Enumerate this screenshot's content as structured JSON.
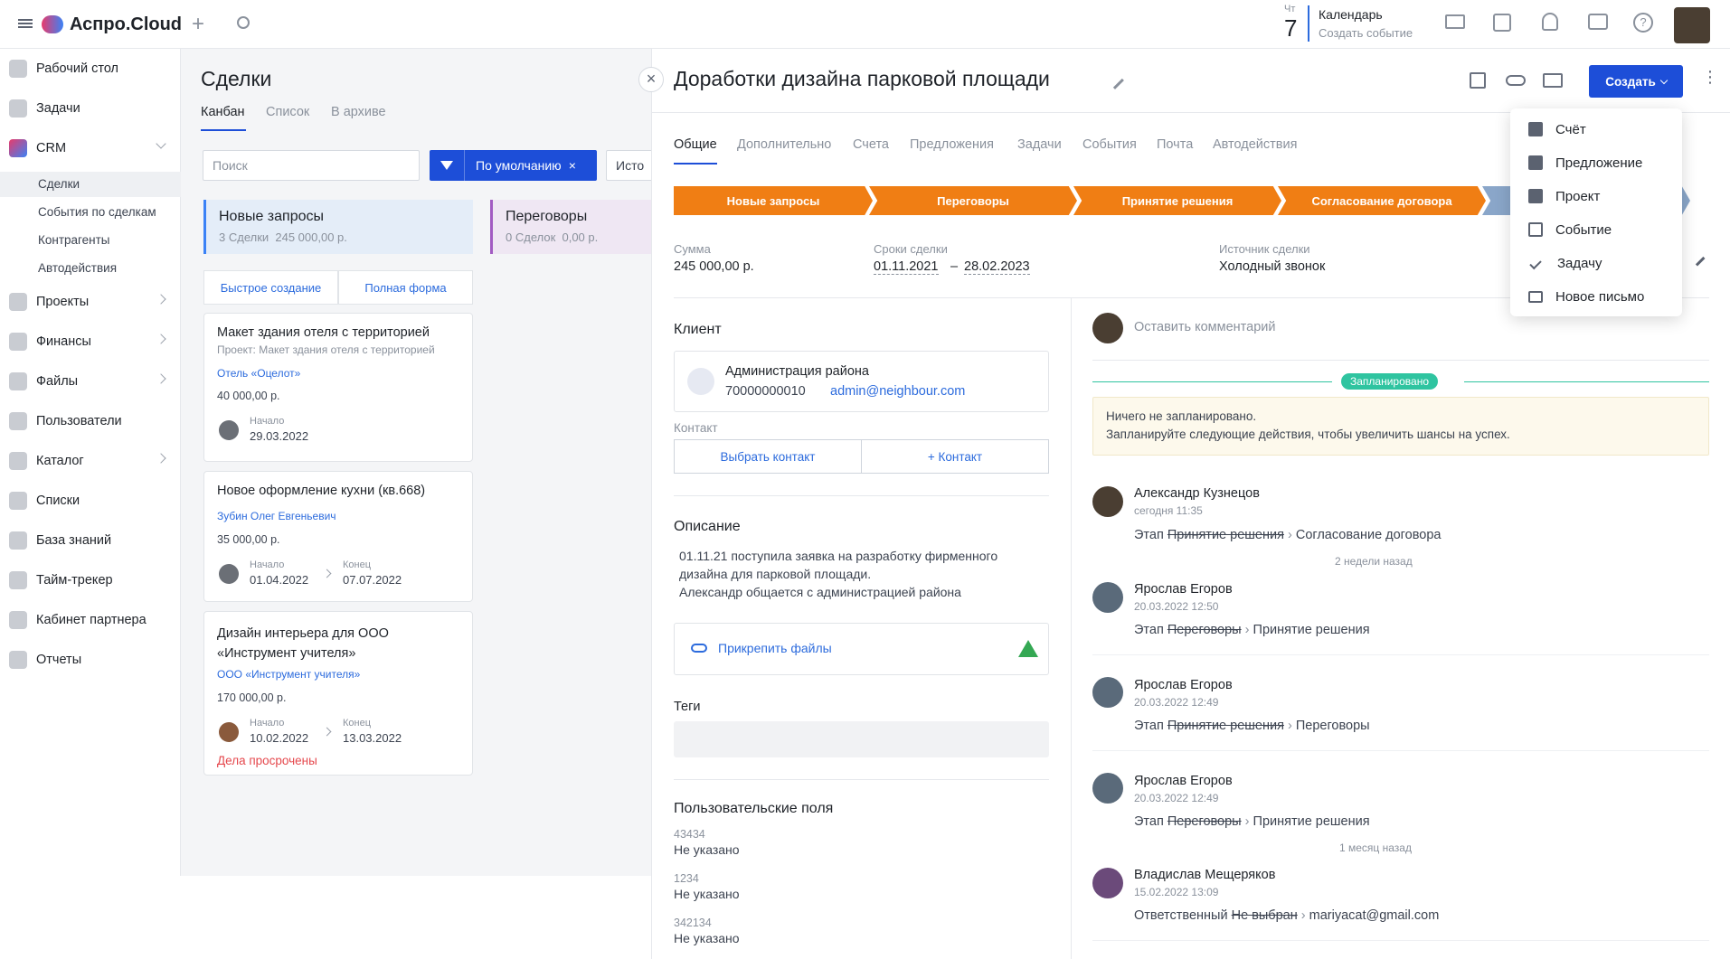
{
  "app": {
    "title": "Аспро.Cloud"
  },
  "topbar": {
    "calendar_dow": "Чт",
    "calendar_day": "7",
    "calendar_title": "Календарь",
    "calendar_sub": "Создать событие"
  },
  "sidebar": {
    "items": [
      {
        "label": "Рабочий стол"
      },
      {
        "label": "Задачи"
      },
      {
        "label": "CRM"
      },
      {
        "label": "Проекты"
      },
      {
        "label": "Финансы"
      },
      {
        "label": "Файлы"
      },
      {
        "label": "Пользователи"
      },
      {
        "label": "Каталог"
      },
      {
        "label": "Списки"
      },
      {
        "label": "База знаний"
      },
      {
        "label": "Тайм-трекер"
      },
      {
        "label": "Кабинет партнера"
      },
      {
        "label": "Отчеты"
      }
    ],
    "crm_sub": [
      "Сделки",
      "События по сделкам",
      "Контрагенты",
      "Автодействия"
    ]
  },
  "board": {
    "title": "Сделки",
    "tabs": [
      "Канбан",
      "Список",
      "В архиве"
    ],
    "search_placeholder": "Поиск",
    "filter_label": "По умолчанию",
    "filter_cut": "Исто",
    "col1_title": "Новые запросы",
    "col1_meta": "3 Сделки  245 000,00 р.",
    "col2_title": "Переговоры",
    "col2_meta": "0 Сделок  0,00 р.",
    "quick_create": "Быстрое создание",
    "full_form": "Полная форма",
    "cards": [
      {
        "title": "Макет здания отеля с территорией",
        "project": "Проект: Макет здания отеля с территорией",
        "client": "Отель «Оцелот»",
        "sum": "40 000,00 р.",
        "start_label": "Начало",
        "start": "29.03.2022"
      },
      {
        "title": "Новое оформление кухни (кв.668)",
        "client": "Зубин Олег Евгеньевич",
        "sum": "35 000,00 р.",
        "start_label": "Начало",
        "start": "01.04.2022",
        "end_label": "Конец",
        "end": "07.07.2022"
      },
      {
        "title": "Дизайн интерьера для ООО «Инструмент учителя»",
        "client": "ООО «Инструмент учителя»",
        "sum": "170 000,00 р.",
        "start_label": "Начало",
        "start": "10.02.2022",
        "end_label": "Конец",
        "end": "13.03.2022",
        "overdue": "Дела просрочены"
      }
    ]
  },
  "deal": {
    "title": "Доработки дизайна парковой площади",
    "create_btn": "Создать",
    "tabs": [
      "Общие",
      "Дополнительно",
      "Счета",
      "Предложения",
      "Задачи",
      "События",
      "Почта",
      "Автодействия"
    ],
    "stages": [
      "Новые запросы",
      "Переговоры",
      "Принятие решения",
      "Согласование договора"
    ],
    "sum_label": "Сумма",
    "sum": "245 000,00 р.",
    "terms_label": "Сроки сделки",
    "term_start": "01.11.2021",
    "term_dash": "–",
    "term_end": "28.02.2023",
    "source_label": "Источник сделки",
    "source": "Холодный звонок",
    "client_heading": "Клиент",
    "client_name": "Администрация района",
    "client_phone": "70000000010",
    "client_email": "admin@neighbour.com",
    "contact_label": "Контакт",
    "choose_contact": "Выбрать контакт",
    "add_contact": "+ Контакт",
    "desc_heading": "Описание",
    "desc_lines": [
      "01.11.21 поступила заявка на разработку фирменного",
      "дизайна для парковой площади.",
      "Александр общается с администрацией района"
    ],
    "attach": "Прикрепить файлы",
    "tags_heading": "Теги",
    "custom_heading": "Пользовательские поля",
    "custom_fields": [
      {
        "name": "43434",
        "value": "Не указано"
      },
      {
        "name": "1234",
        "value": "Не указано"
      },
      {
        "name": "342134",
        "value": "Не указано"
      }
    ]
  },
  "feed": {
    "comment_placeholder": "Оставить комментарий",
    "planned_badge": "Запланировано",
    "planned_line1": "Ничего не запланировано.",
    "planned_line2": "Запланируйте следующие действия, чтобы увеличить шансы на успех.",
    "sep1": "2 недели назад",
    "sep2": "1 месяц назад",
    "entries": [
      {
        "name": "Александр Кузнецов",
        "time": "сегодня 11:35",
        "prefix": "Этап",
        "old": "Принятие решения",
        "new": "Согласование договора"
      },
      {
        "name": "Ярослав Егоров",
        "time": "20.03.2022 12:50",
        "prefix": "Этап",
        "old": "Переговоры",
        "new": "Принятие решения"
      },
      {
        "name": "Ярослав Егоров",
        "time": "20.03.2022 12:49",
        "prefix": "Этап",
        "old": "Принятие решения",
        "new": "Переговоры"
      },
      {
        "name": "Ярослав Егоров",
        "time": "20.03.2022 12:49",
        "prefix": "Этап",
        "old": "Переговоры",
        "new": "Принятие решения"
      },
      {
        "name": "Владислав Мещеряков",
        "time": "15.02.2022 13:09",
        "prefix": "Ответственный",
        "old": "Не выбран",
        "new": "mariyacat@gmail.com"
      }
    ]
  },
  "menu": {
    "items": [
      "Счёт",
      "Предложение",
      "Проект",
      "Событие",
      "Задачу",
      "Новое письмо"
    ]
  },
  "colors": {
    "accent": "#1d4ed8",
    "stage": "#f07e14",
    "link": "#2c6bdd",
    "planned": "#2fc4a0"
  }
}
